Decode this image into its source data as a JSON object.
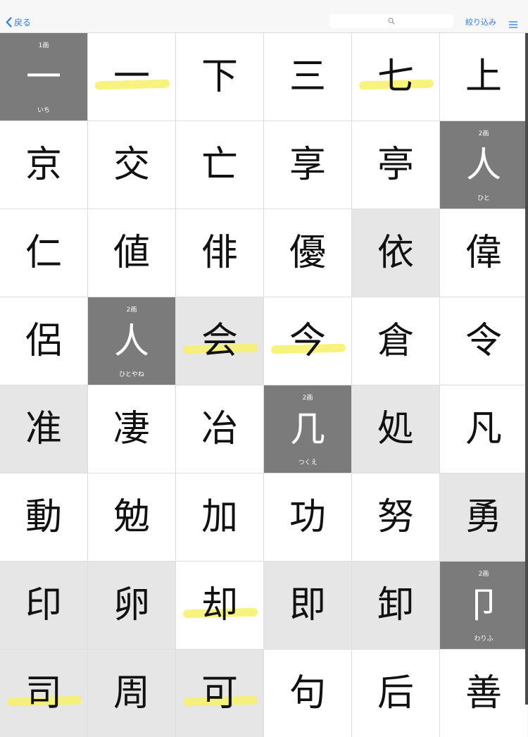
{
  "nav": {
    "back_label": "戻る",
    "filter_label": "絞り込み",
    "search_placeholder": "",
    "accent_color": "#2a7bf6"
  },
  "highlight_color": "#f7f068",
  "cells": [
    {
      "char": "一",
      "type": "radical",
      "strokes": "1画",
      "reading": "いち"
    },
    {
      "char": "一",
      "type": "normal",
      "highlight": true
    },
    {
      "char": "下",
      "type": "normal"
    },
    {
      "char": "三",
      "type": "normal"
    },
    {
      "char": "七",
      "type": "normal",
      "highlight": true
    },
    {
      "char": "上",
      "type": "normal"
    },
    {
      "char": "京",
      "type": "normal"
    },
    {
      "char": "交",
      "type": "normal"
    },
    {
      "char": "亡",
      "type": "normal"
    },
    {
      "char": "享",
      "type": "normal"
    },
    {
      "char": "亭",
      "type": "normal"
    },
    {
      "char": "人",
      "type": "radical",
      "strokes": "2画",
      "reading": "ひと"
    },
    {
      "char": "仁",
      "type": "normal"
    },
    {
      "char": "値",
      "type": "normal"
    },
    {
      "char": "俳",
      "type": "normal"
    },
    {
      "char": "優",
      "type": "normal"
    },
    {
      "char": "依",
      "type": "light"
    },
    {
      "char": "偉",
      "type": "normal"
    },
    {
      "char": "侶",
      "type": "normal"
    },
    {
      "char": "人",
      "type": "radical",
      "strokes": "2画",
      "reading": "ひとやね"
    },
    {
      "char": "会",
      "type": "light",
      "highlight": true
    },
    {
      "char": "今",
      "type": "normal",
      "highlight": true
    },
    {
      "char": "倉",
      "type": "normal"
    },
    {
      "char": "令",
      "type": "normal"
    },
    {
      "char": "准",
      "type": "light"
    },
    {
      "char": "凄",
      "type": "normal"
    },
    {
      "char": "冶",
      "type": "normal"
    },
    {
      "char": "几",
      "type": "radical",
      "strokes": "2画",
      "reading": "つくえ"
    },
    {
      "char": "処",
      "type": "light"
    },
    {
      "char": "凡",
      "type": "normal"
    },
    {
      "char": "動",
      "type": "normal"
    },
    {
      "char": "勉",
      "type": "normal"
    },
    {
      "char": "加",
      "type": "normal"
    },
    {
      "char": "功",
      "type": "normal"
    },
    {
      "char": "努",
      "type": "normal"
    },
    {
      "char": "勇",
      "type": "light"
    },
    {
      "char": "印",
      "type": "light"
    },
    {
      "char": "卵",
      "type": "light"
    },
    {
      "char": "却",
      "type": "normal",
      "highlight": true
    },
    {
      "char": "即",
      "type": "light"
    },
    {
      "char": "卸",
      "type": "light"
    },
    {
      "char": "卩",
      "type": "radical",
      "strokes": "2画",
      "reading": "わりふ"
    },
    {
      "char": "司",
      "type": "light",
      "highlight": true
    },
    {
      "char": "周",
      "type": "light"
    },
    {
      "char": "可",
      "type": "light",
      "highlight": true
    },
    {
      "char": "句",
      "type": "normal"
    },
    {
      "char": "后",
      "type": "normal"
    },
    {
      "char": "善",
      "type": "normal"
    }
  ]
}
